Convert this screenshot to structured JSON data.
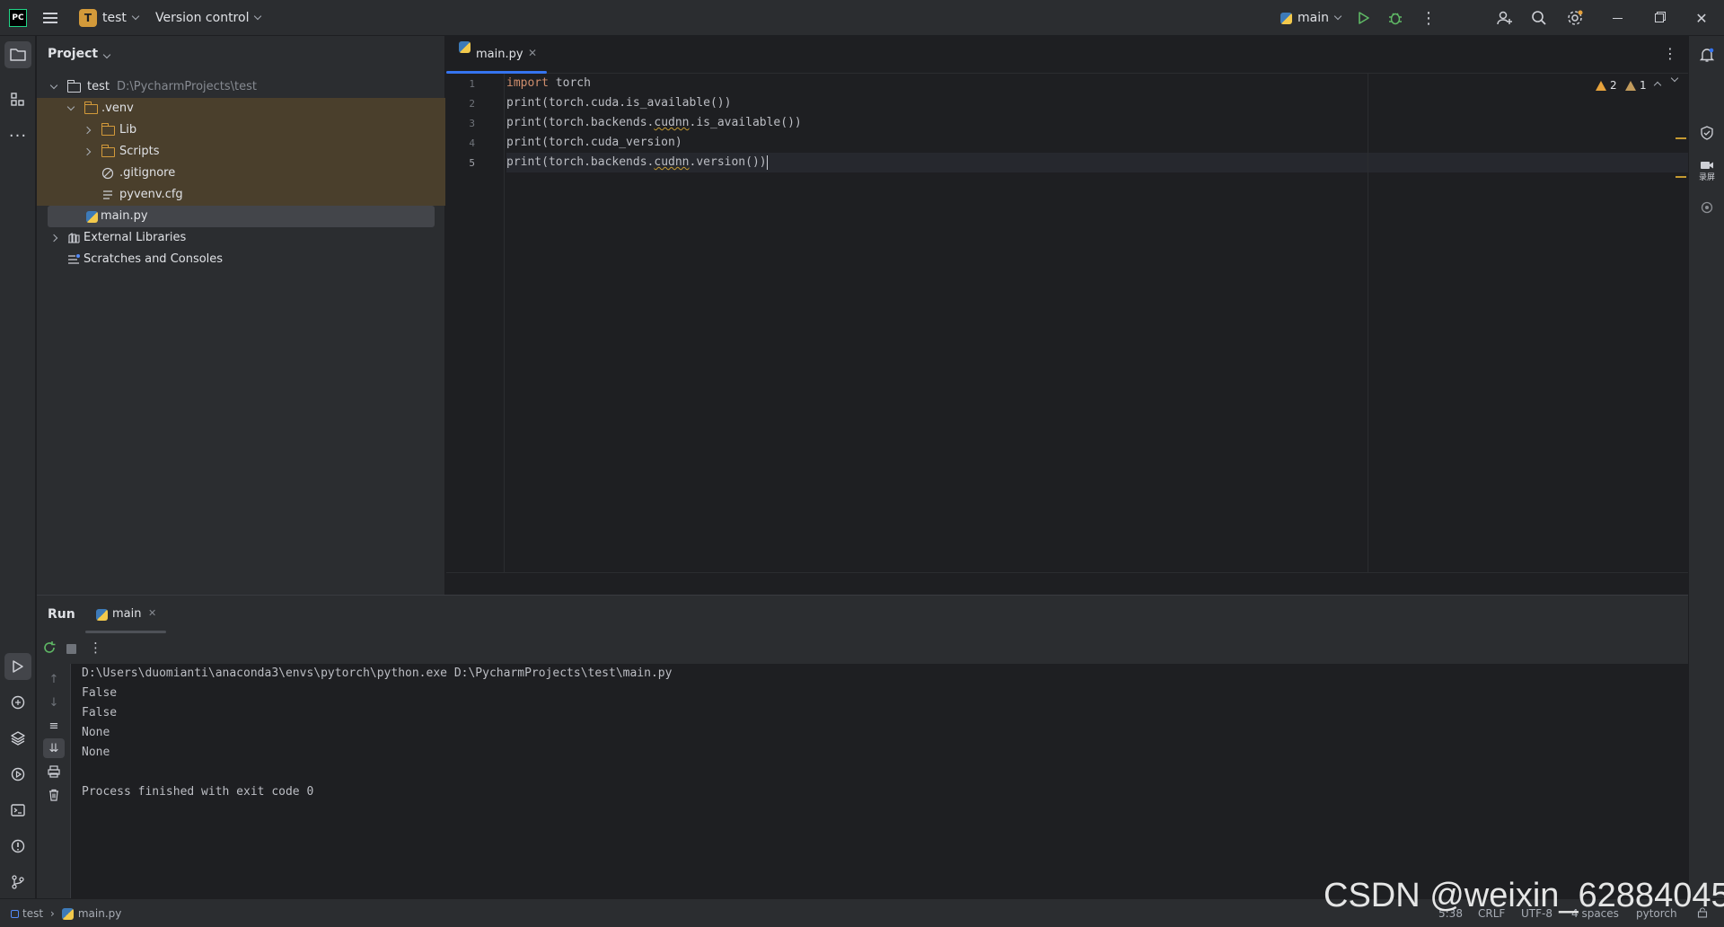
{
  "titlebar": {
    "app_logo": "PC",
    "project_badge": "T",
    "project_name": "test",
    "vcs": "Version control",
    "run_config": "main"
  },
  "project_panel": {
    "title": "Project",
    "tree": [
      {
        "label": "test",
        "path": "D:\\PycharmProjects\\test"
      },
      {
        "label": ".venv"
      },
      {
        "label": "Lib"
      },
      {
        "label": "Scripts"
      },
      {
        "label": ".gitignore"
      },
      {
        "label": "pyvenv.cfg"
      },
      {
        "label": "main.py"
      },
      {
        "label": "External Libraries"
      },
      {
        "label": "Scratches and Consoles"
      }
    ]
  },
  "editor": {
    "tab": "main.py",
    "line_numbers": [
      "1",
      "2",
      "3",
      "4",
      "5"
    ],
    "inspections": {
      "warnings": "2",
      "weak_warnings": "1"
    },
    "code": {
      "l1_kw": "import",
      "l1_rest": " torch",
      "l2": "print(torch.cuda.is_available())",
      "l3_a": "print(torch.backends.",
      "l3_b": "cudnn",
      "l3_c": ".is_available())",
      "l4": "print(torch.cuda_version)",
      "l5_a": "print(torch.backends.",
      "l5_b": "cudnn",
      "l5_c": ".version())"
    }
  },
  "run_panel": {
    "title": "Run",
    "tab": "main",
    "output": [
      "D:\\Users\\duomianti\\anaconda3\\envs\\pytorch\\python.exe D:\\PycharmProjects\\test\\main.py",
      "False",
      "False",
      "None",
      "None",
      "",
      "Process finished with exit code 0"
    ]
  },
  "statusbar": {
    "breadcrumb": [
      "test",
      "main.py"
    ],
    "position": "5:38",
    "line_sep": "CRLF",
    "encoding": "UTF-8",
    "indent": "4 spaces",
    "interpreter": "pytorch"
  },
  "watermark": "CSDN @weixin_62884045",
  "right_strip": {
    "record_label": "录屏"
  }
}
